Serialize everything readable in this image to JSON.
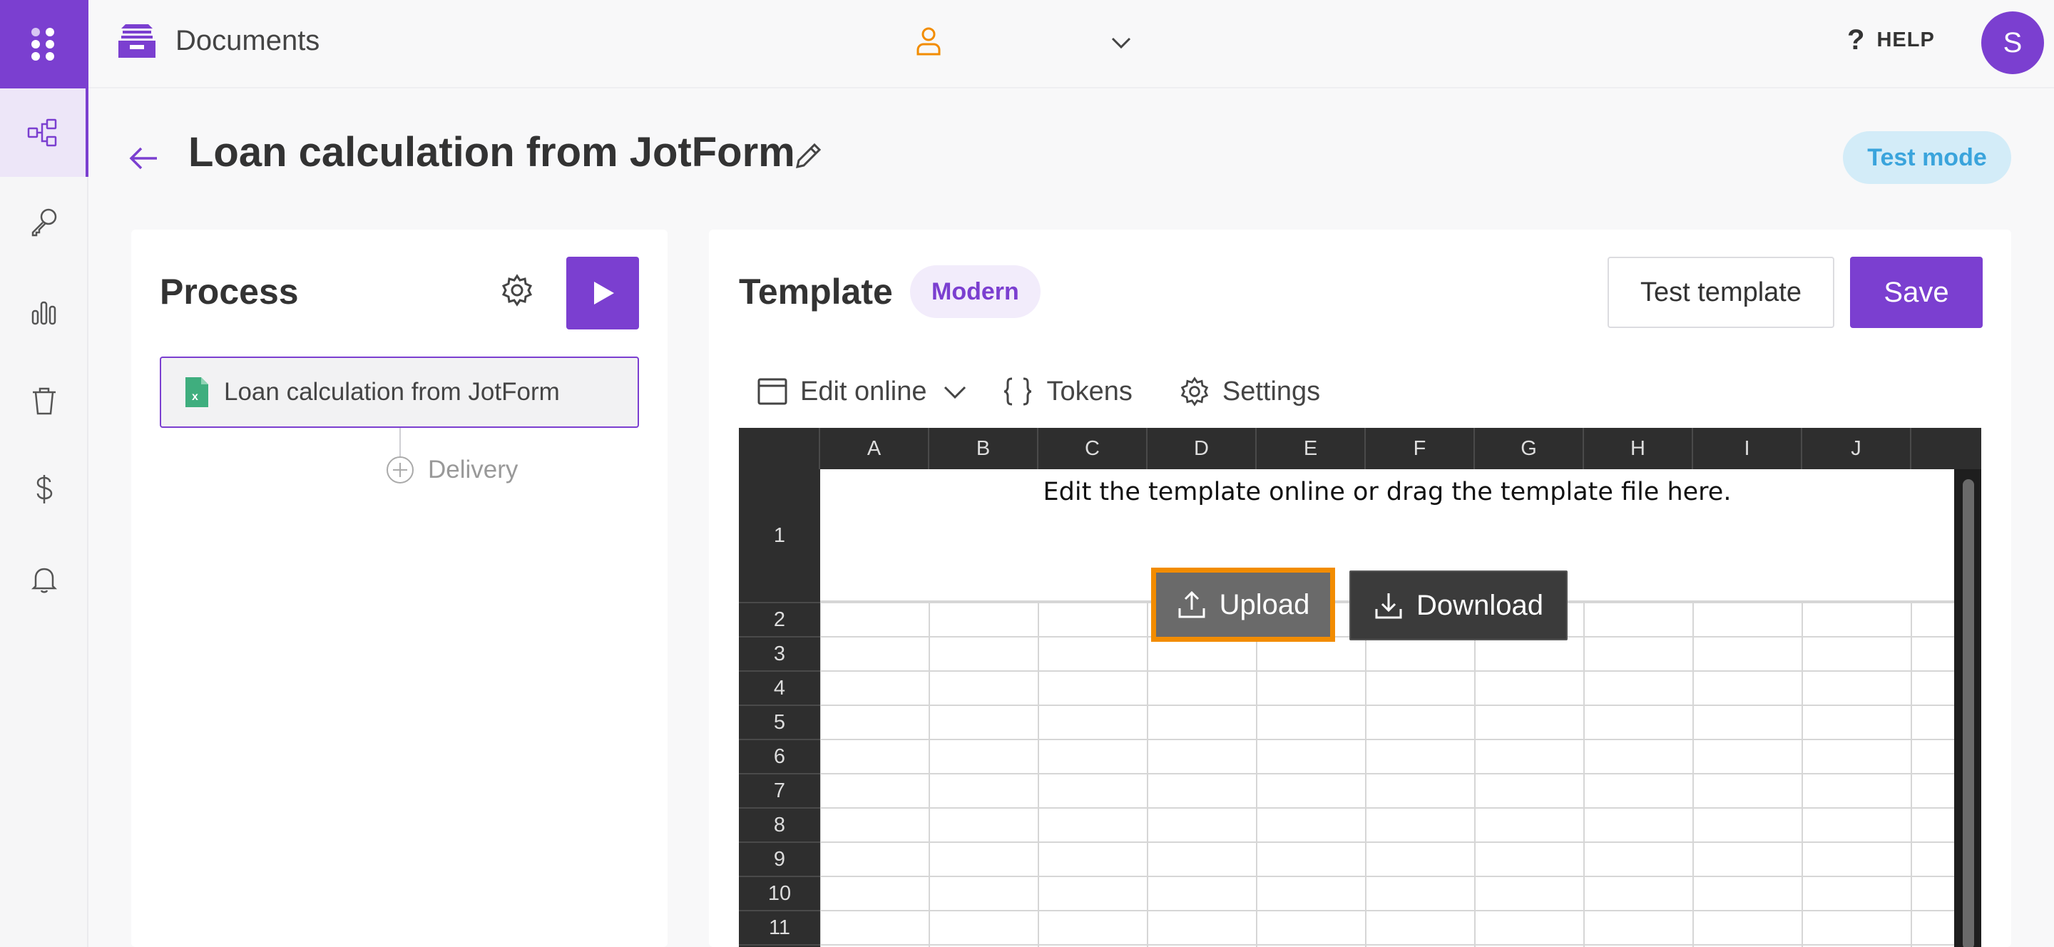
{
  "topbar": {
    "app_name": "Documents",
    "help_label": "HELP",
    "avatar_initial": "S"
  },
  "header": {
    "title": "Loan calculation from JotForm",
    "test_mode_label": "Test mode"
  },
  "process": {
    "title": "Process",
    "item_label": "Loan calculation from JotForm",
    "delivery_label": "Delivery"
  },
  "template": {
    "title": "Template",
    "badge": "Modern",
    "test_button": "Test template",
    "save_button": "Save",
    "toolbar": {
      "edit_online": "Edit online",
      "tokens": "Tokens",
      "settings": "Settings"
    },
    "sheet": {
      "columns": [
        "A",
        "B",
        "C",
        "D",
        "E",
        "F",
        "G",
        "H",
        "I",
        "J"
      ],
      "rows": [
        "1",
        "2",
        "3",
        "4",
        "5",
        "6",
        "7",
        "8",
        "9",
        "10",
        "11"
      ],
      "message": "Edit the template online or drag the template file here.",
      "upload_label": "Upload",
      "download_label": "Download"
    }
  },
  "colors": {
    "accent": "#7b3fd0",
    "highlight": "#f28c00",
    "test_mode_bg": "#d3ecf8",
    "test_mode_text": "#3aa4dc"
  },
  "rail_icons": [
    "apps-icon",
    "workflow-icon",
    "key-icon",
    "bar-chart-icon",
    "trash-icon",
    "dollar-icon",
    "bell-icon"
  ]
}
